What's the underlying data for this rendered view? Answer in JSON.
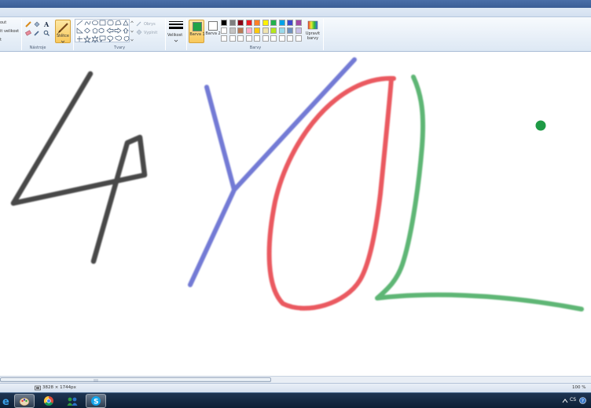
{
  "ribbon": {
    "clipboard": {
      "cut_label": "out",
      "resize_label": "it velikost",
      "rotate_label": "t"
    },
    "tools": {
      "group_label": "Nástroje"
    },
    "brushes": {
      "label": "Štětce"
    },
    "shapes": {
      "group_label": "Tvary",
      "outline_label": "Obrys",
      "fill_label": "Vyplnit"
    },
    "size": {
      "label": "Velikost"
    },
    "colors": {
      "group_label": "Barvy",
      "color1_label": "Barva 1",
      "color2_label": "Barva 2",
      "edit_label": "Upravit barvy",
      "color1": "#22a347",
      "color2": "#ffffff",
      "palette": [
        "#000000",
        "#7f7f7f",
        "#880015",
        "#ed1c24",
        "#ff7f27",
        "#fff200",
        "#22b14c",
        "#00a2e8",
        "#3f48cc",
        "#a349a4",
        "#ffffff",
        "#c3c3c3",
        "#b97a57",
        "#ffaec9",
        "#ffc90e",
        "#efe4b0",
        "#b5e61d",
        "#99d9ea",
        "#7092be",
        "#c8bfe7",
        "#ffffff",
        "#ffffff",
        "#ffffff",
        "#ffffff",
        "#ffffff",
        "#ffffff",
        "#ffffff",
        "#ffffff",
        "#ffffff",
        "#ffffff"
      ]
    }
  },
  "canvas": {
    "strokes": [
      {
        "name": "stroke-4",
        "color": "#1f1f1f"
      },
      {
        "name": "stroke-y",
        "color": "#4b55c9"
      },
      {
        "name": "stroke-o",
        "color": "#e5303a"
      },
      {
        "name": "stroke-l",
        "color": "#2fa14d"
      }
    ],
    "dot_color": "#1e9a45"
  },
  "status": {
    "dimensions": "3828 × 1744px",
    "zoom": "100 %"
  },
  "taskbar": {
    "language": "CS",
    "apps": [
      "internet-explorer",
      "paint",
      "chrome",
      "messenger",
      "skype"
    ]
  }
}
